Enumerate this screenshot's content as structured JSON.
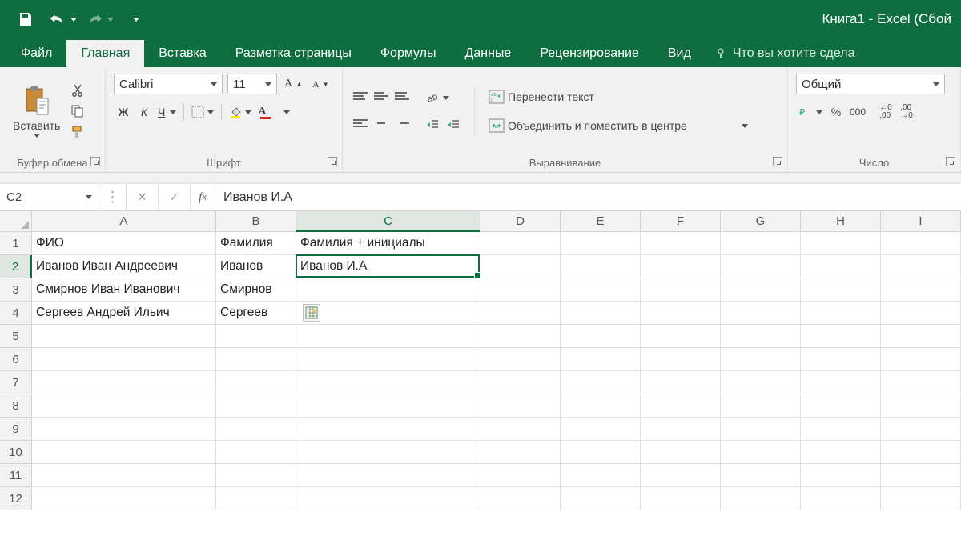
{
  "app": {
    "title": "Книга1 - Excel (Сбой "
  },
  "tabs": {
    "items": [
      "Файл",
      "Главная",
      "Вставка",
      "Разметка страницы",
      "Формулы",
      "Данные",
      "Рецензирование",
      "Вид"
    ],
    "active": 1,
    "tellme": "Что вы хотите сдела"
  },
  "ribbon": {
    "clipboard": {
      "paste": "Вставить",
      "label": "Буфер обмена"
    },
    "font": {
      "name": "Calibri",
      "size": "11",
      "bold": "Ж",
      "italic": "К",
      "underline": "Ч",
      "label": "Шрифт"
    },
    "alignment": {
      "wrap": "Перенести текст",
      "merge": "Объединить и поместить в центре",
      "label": "Выравнивание"
    },
    "number": {
      "format": "Общий",
      "label": "Число"
    }
  },
  "namebox": "C2",
  "formula": "Иванов И.А",
  "columns": [
    "A",
    "B",
    "C",
    "D",
    "E",
    "F",
    "G",
    "H",
    "I"
  ],
  "rows": [
    "1",
    "2",
    "3",
    "4",
    "5",
    "6",
    "7",
    "8",
    "9",
    "10",
    "11",
    "12"
  ],
  "cells": {
    "A1": "ФИО",
    "B1": "Фамилия",
    "C1": "Фамилия + инициалы",
    "A2": "Иванов Иван Андреевич",
    "B2": "Иванов",
    "C2": "Иванов И.А",
    "A3": "Смирнов Иван Иванович",
    "B3": "Смирнов",
    "A4": "Сергеев Андрей Ильич",
    "B4": "Сергеев"
  },
  "selection": {
    "col": "C",
    "row": "2"
  }
}
